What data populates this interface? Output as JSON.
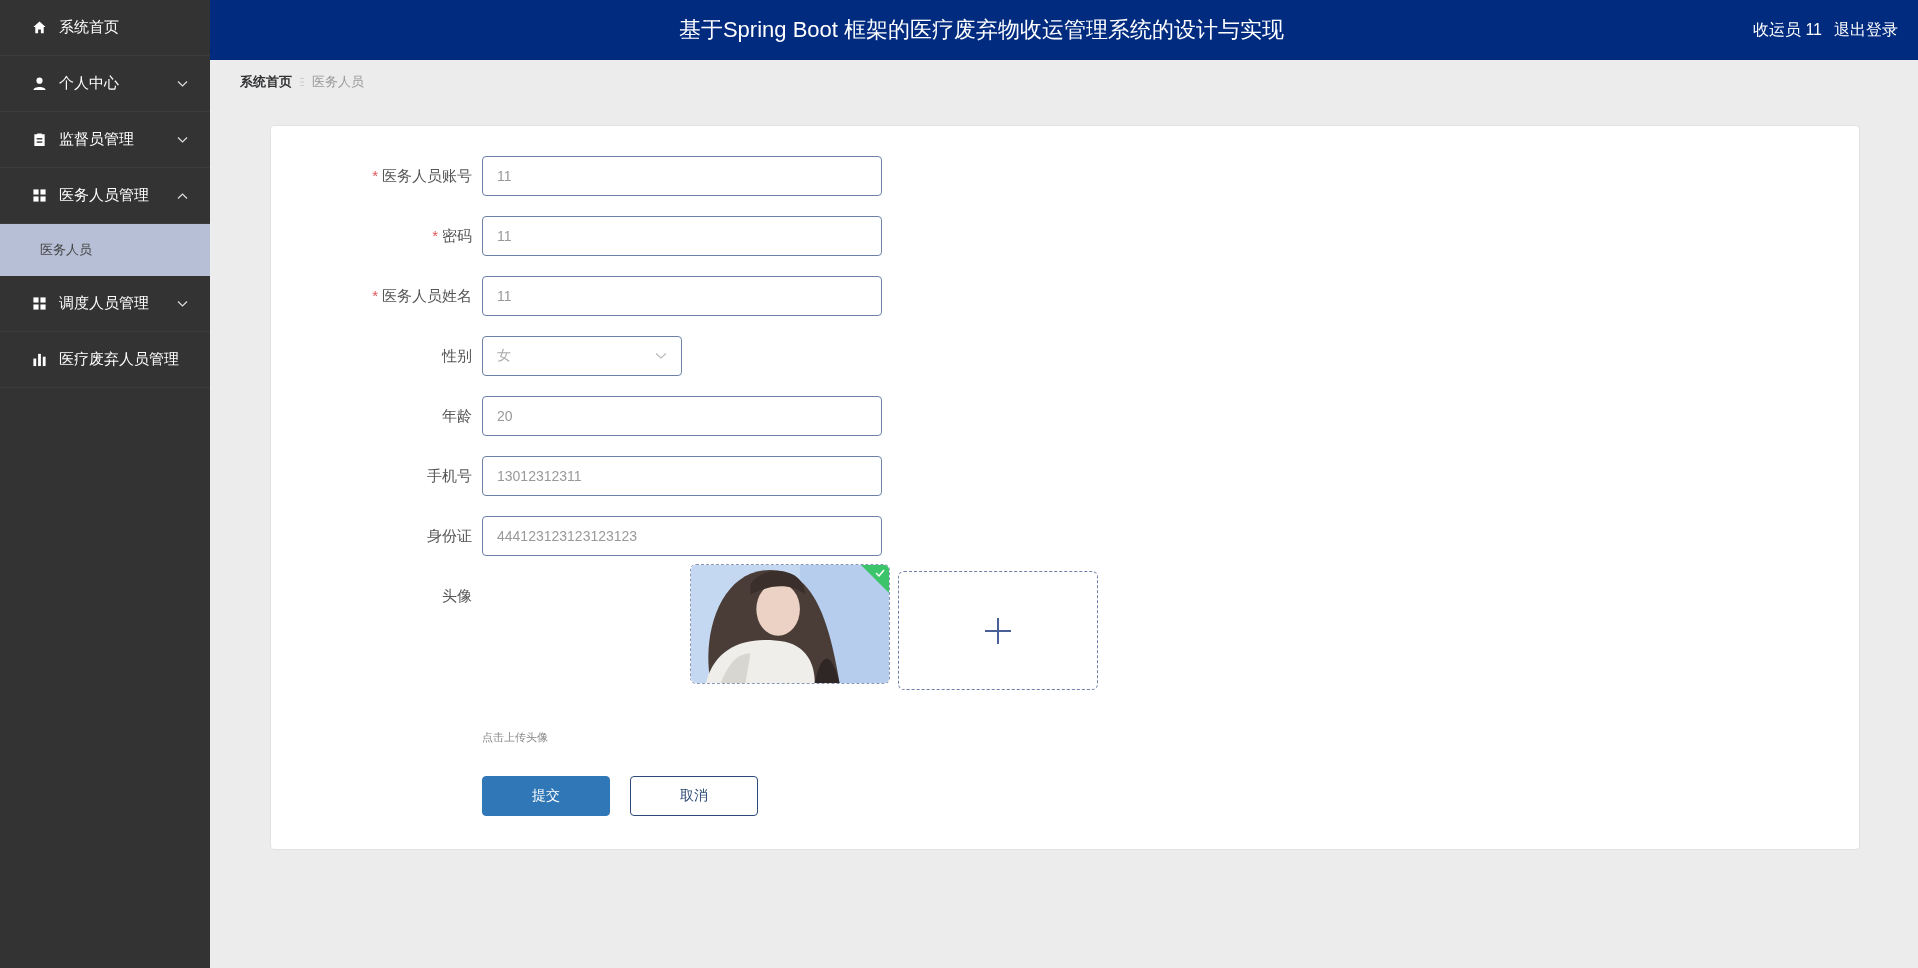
{
  "sidebar": {
    "items": [
      {
        "label": "系统首页",
        "selected": false
      },
      {
        "label": "个人中心",
        "selected": false,
        "expanded": false
      },
      {
        "label": "监督员管理",
        "selected": false,
        "expanded": false
      },
      {
        "label": "医务人员管理",
        "selected": false,
        "expanded": true,
        "children": [
          {
            "label": "医务人员",
            "selected": true
          }
        ]
      },
      {
        "label": "调度人员管理",
        "selected": false,
        "expanded": false
      },
      {
        "label": "医疗废弃人员管理",
        "selected": false
      }
    ]
  },
  "header": {
    "title": "基于Spring Boot 框架的医疗废弃物收运管理系统的设计与实现",
    "user": "收运员 11",
    "logout": "退出登录"
  },
  "breadcrumb": [
    "系统首页",
    "医务人员"
  ],
  "form": {
    "fields": [
      {
        "kind": "input",
        "mark": "*",
        "label": "医务人员账号",
        "value": "11"
      },
      {
        "kind": "input",
        "mark": "*",
        "label": "密码",
        "value": "11"
      },
      {
        "kind": "input",
        "mark": "*",
        "label": "医务人员姓名",
        "value": "11"
      },
      {
        "kind": "select",
        "label": "性别",
        "value": "女"
      },
      {
        "kind": "input",
        "label": "年龄",
        "value": "20"
      },
      {
        "kind": "input",
        "label": "手机号",
        "value": "13012312311"
      },
      {
        "kind": "input",
        "label": "身份证",
        "value": "444123123123123123"
      },
      {
        "kind": "upload",
        "label": "头像",
        "hint": "点击上传头像"
      }
    ],
    "buttons": [
      {
        "kind": "primary",
        "label": "提交"
      },
      {
        "kind": "secondary",
        "label": "取消"
      }
    ]
  }
}
